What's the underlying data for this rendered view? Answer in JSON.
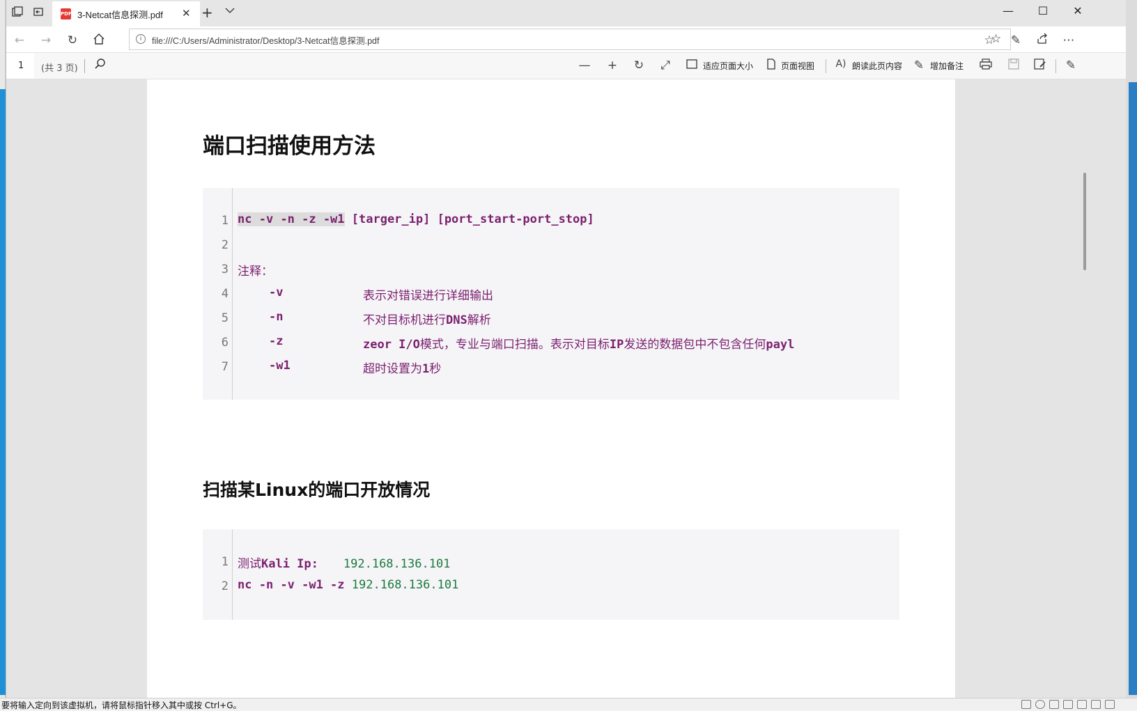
{
  "browser": {
    "tab_title": "3-Netcat信息探测.pdf",
    "tab_icon": "pdf-file-icon",
    "address": "file:///C:/Users/Administrator/Desktop/3-Netcat信息探测.pdf",
    "icons": {
      "set_aside": "tabs-aside-icon",
      "show_tabs": "tab-preview-icon",
      "new_tab": "plus-icon",
      "tab_list": "chevron-down-icon",
      "back": "arrow-left-icon",
      "forward": "arrow-right-icon",
      "refresh": "refresh-icon",
      "home": "home-icon",
      "favorite": "star-icon",
      "favorites_list": "star-list-icon",
      "notes": "pen-icon",
      "share": "share-icon",
      "more": "ellipsis-icon"
    }
  },
  "pdf_toolbar": {
    "page_number": "1",
    "page_total": "(共 3 页)",
    "fit_page_label": "适应页面大小",
    "page_view_label": "页面视图",
    "read_aloud_label": "朗读此页内容",
    "add_notes_label": "增加备注"
  },
  "document": {
    "heading1": "端口扫描使用方法",
    "code1": {
      "line_numbers": [
        "1",
        "2",
        "3",
        "4",
        "5",
        "6",
        "7"
      ],
      "line1_cmd": "nc -v -n -z -w1",
      "line1_args": " [targer_ip] [port_start-port_stop]",
      "line3": "注释：",
      "opt4": "-v",
      "desc4": "表示对错误进行详细输出",
      "opt5": "-n",
      "desc5_a": "不对目标机进行",
      "desc5_b": "DNS",
      "desc5_c": "解析",
      "opt6": "-z",
      "desc6_a": "zeor I/O",
      "desc6_b": "模式，专业与端口扫描。表示对目标",
      "desc6_c": "IP",
      "desc6_d": "发送的数据包中不包含任何",
      "desc6_e": "payl",
      "opt7": "-w1",
      "desc7_a": "超时设置为",
      "desc7_b": "1",
      "desc7_c": "秒"
    },
    "heading2": "扫描某Linux的端口开放情况",
    "code2": {
      "line_numbers": [
        "1",
        "2"
      ],
      "line1_a": "测试",
      "line1_b": "Kali Ip:",
      "line1_ip": "192.168.136.101",
      "line2_cmd": "nc -n -v -w1 -z",
      "line2_ip": "192.168.136.101"
    }
  },
  "status_bar": {
    "text": "要将输入定向到该虚拟机，请将鼠标指针移入其中或按 Ctrl+G。"
  }
}
